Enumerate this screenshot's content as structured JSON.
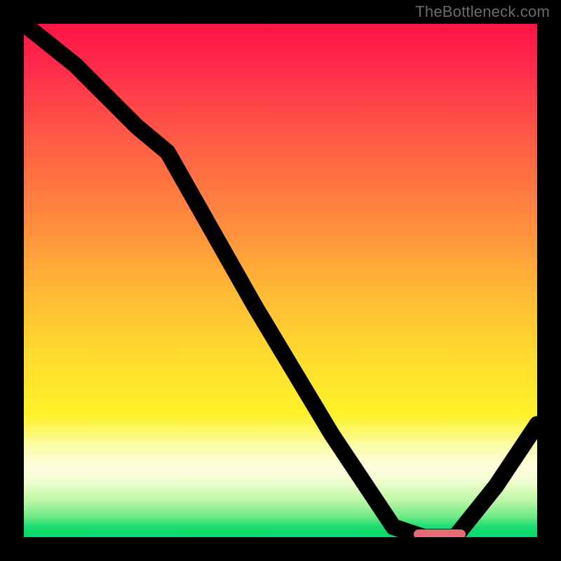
{
  "watermark": "TheBottleneck.com",
  "colors": {
    "top": "#ff1446",
    "mid_orange": "#ff8a3e",
    "mid_yellow": "#ffde2e",
    "pale": "#fbfcd0",
    "green": "#00d86c",
    "curve": "#000000",
    "marker": "#e86a72",
    "border": "#000000",
    "page_bg": "#000000"
  },
  "plot": {
    "x_range": [
      0,
      100
    ],
    "y_range": [
      0,
      100
    ]
  },
  "chart_data": {
    "type": "line",
    "title": "",
    "xlabel": "",
    "ylabel": "",
    "xlim": [
      0,
      100
    ],
    "ylim": [
      0,
      100
    ],
    "series": [
      {
        "name": "bottleneck-curve",
        "x": [
          0,
          10,
          22,
          28,
          45,
          60,
          72,
          78,
          84,
          92,
          100
        ],
        "y": [
          100,
          92,
          80,
          75,
          45,
          20,
          2,
          0,
          0,
          10,
          22
        ]
      }
    ],
    "marker": {
      "name": "optimal-range",
      "x_start": 76,
      "x_end": 86,
      "y": 0
    },
    "annotations": []
  }
}
